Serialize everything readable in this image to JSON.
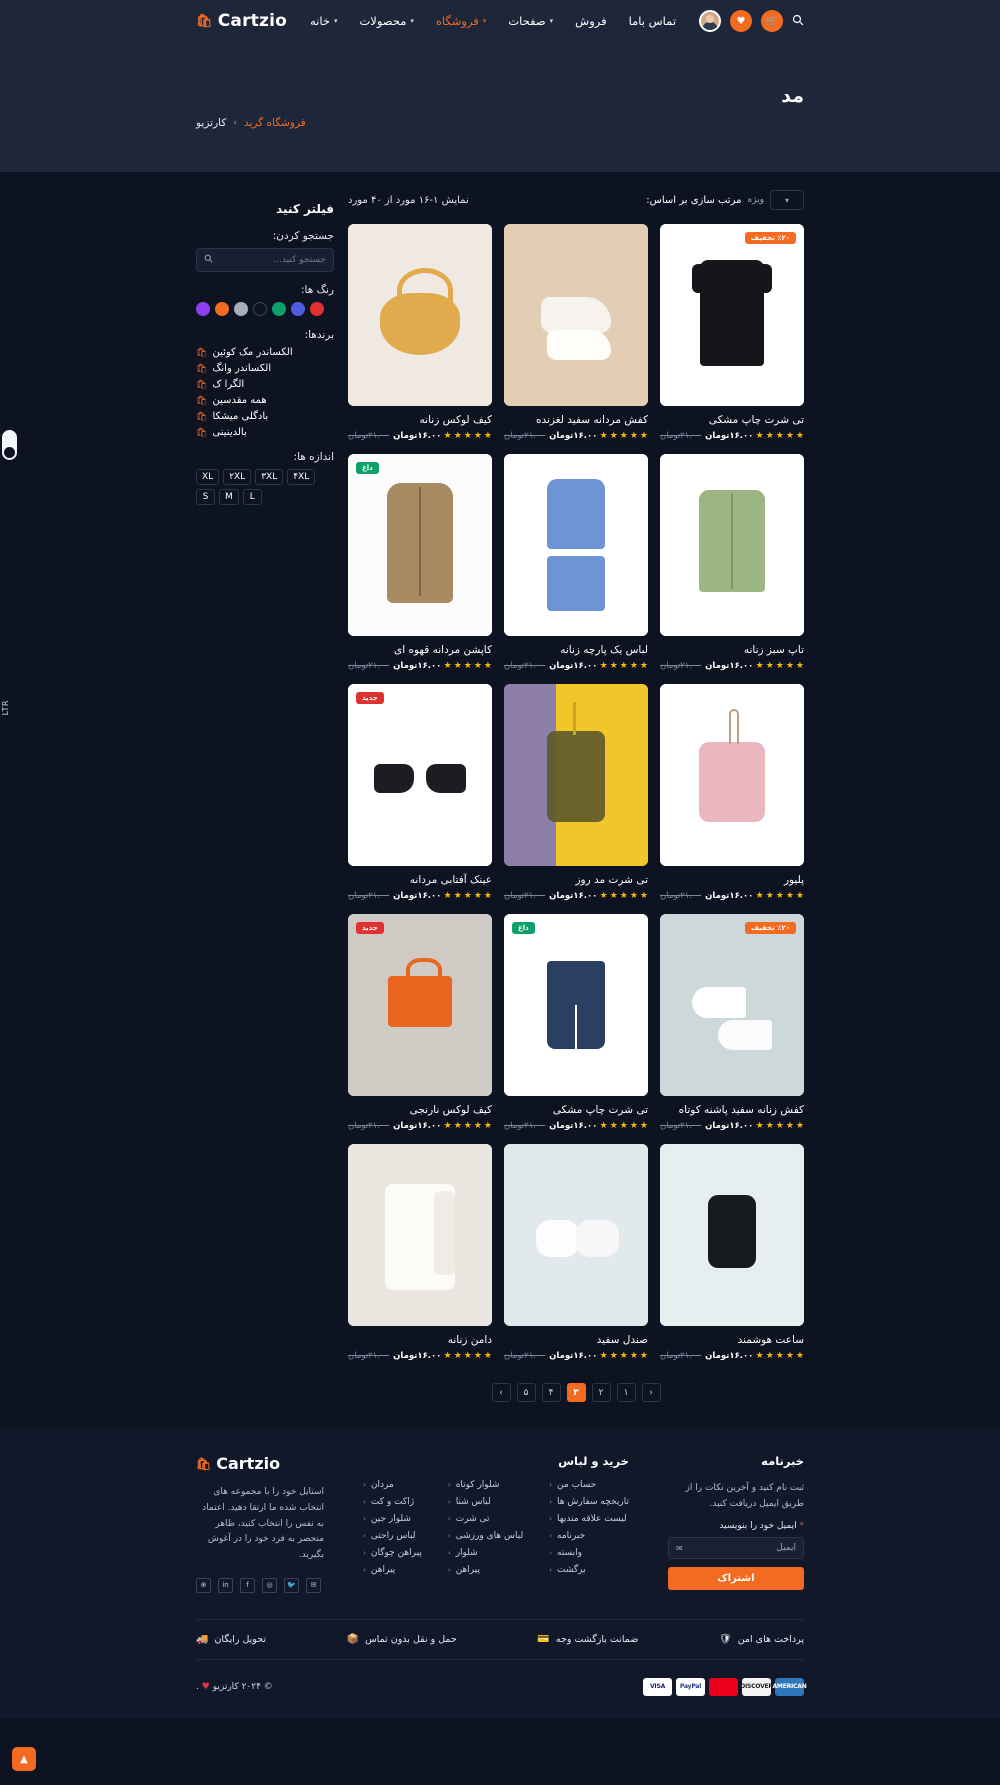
{
  "brand": {
    "name": "Cartzio",
    "icon": "shopping-bag-icon"
  },
  "nav": {
    "items": [
      {
        "label": "خانه",
        "has_caret": true,
        "active": false
      },
      {
        "label": "محصولات",
        "has_caret": true,
        "active": false
      },
      {
        "label": "فروشگاه",
        "has_caret": true,
        "active": true
      },
      {
        "label": "صفحات",
        "has_caret": true,
        "active": false
      },
      {
        "label": "فروش",
        "has_caret": false,
        "active": false
      },
      {
        "label": "تماس باما",
        "has_caret": false,
        "active": false
      }
    ],
    "icons": [
      "search-icon",
      "cart-icon",
      "heart-icon",
      "avatar"
    ]
  },
  "page": {
    "title": "مد",
    "breadcrumb": {
      "home": "کارتزیو",
      "separator": "›",
      "current": "فروشگاه گرید"
    }
  },
  "sidebar": {
    "title": "فیلتر کنید",
    "search_label": "جستجو کردن:",
    "search_placeholder": "جستجو کنید...",
    "colors_label": "رنگ ها:",
    "colors": [
      "#e03131",
      "#4f5ee0",
      "#0ea06a",
      "#0d1321",
      "#a7adb8",
      "#f26b21",
      "#8e3ff0"
    ],
    "brands_label": "برندها:",
    "brands": [
      "الکساندر مک کوئین",
      "الکساندر وانگ",
      "الگرا ک",
      "همه مقدسین",
      "بادگلی میشکا",
      "بالدینینی"
    ],
    "sizes_label": "اندازه ها:",
    "sizes": [
      "S",
      "M",
      "L",
      "XL",
      "۲XL",
      "۳XL",
      "۴XL"
    ]
  },
  "toolbar": {
    "result_count": "نمایش ۱-۱۶ مورد از ۴۰ مورد",
    "sort_label": "مرتب سازی بر اساس:",
    "sort_value": "ویژه",
    "sort_caret": "chevron-down-icon"
  },
  "products": [
    {
      "name": "تی شرت چاپ مشکی",
      "price": "۱۶.۰۰تومان",
      "old_price": "۲۱.۰۰تومان",
      "rating": 5,
      "badge": "٪۲۰ تخفیف",
      "badge_type": "orange",
      "art": "a-shirt"
    },
    {
      "name": "کفش مردانه سفید لغزنده",
      "price": "۱۶.۰۰تومان",
      "old_price": "۲۱.۰۰تومان",
      "rating": 5,
      "badge": "",
      "badge_type": "",
      "art": "a-shoe"
    },
    {
      "name": "کیف لوکس زنانه",
      "price": "۱۶.۰۰تومان",
      "old_price": "۲۱.۰۰تومان",
      "rating": 5,
      "badge": "",
      "badge_type": "",
      "art": "a-bag"
    },
    {
      "name": "تاپ سبز زنانه",
      "price": "۱۶.۰۰تومان",
      "old_price": "۲۱.۰۰تومان",
      "rating": 5,
      "badge": "",
      "badge_type": "",
      "art": "a-green"
    },
    {
      "name": "لباس یک پارچه زنانه",
      "price": "۱۶.۰۰تومان",
      "old_price": "۲۱.۰۰تومان",
      "rating": 5,
      "badge": "",
      "badge_type": "",
      "art": "a-dress"
    },
    {
      "name": "کاپشن مردانه قهوه ای",
      "price": "۱۶.۰۰تومان",
      "old_price": "۲۱.۰۰تومان",
      "rating": 5,
      "badge": "داغ",
      "badge_type": "green",
      "art": "a-jacket"
    },
    {
      "name": "پلیور",
      "price": "۱۶.۰۰تومان",
      "old_price": "۲۱.۰۰تومان",
      "rating": 5,
      "badge": "",
      "badge_type": "",
      "art": "a-pull"
    },
    {
      "name": "تی شرت مد روز",
      "price": "۱۶.۰۰تومان",
      "old_price": "۲۱.۰۰تومان",
      "rating": 5,
      "badge": "",
      "badge_type": "",
      "art": "a-tee"
    },
    {
      "name": "عینک آفتابی مردانه",
      "price": "۱۶.۰۰تومان",
      "old_price": "۲۱.۰۰تومان",
      "rating": 5,
      "badge": "جدید",
      "badge_type": "red",
      "art": "a-glass"
    },
    {
      "name": "کفش زنانه سفید پاشنه کوتاه",
      "price": "۱۶.۰۰تومان",
      "old_price": "۲۱.۰۰تومان",
      "rating": 5,
      "badge": "٪۲۰ تخفیف",
      "badge_type": "orange",
      "art": "a-heel"
    },
    {
      "name": "تی شرت چاپ مشکی",
      "price": "۱۶.۰۰تومان",
      "old_price": "۲۱.۰۰تومان",
      "rating": 5,
      "badge": "داغ",
      "badge_type": "green",
      "art": "a-short"
    },
    {
      "name": "کیف لوکس نارنجی",
      "price": "۱۶.۰۰تومان",
      "old_price": "۲۱.۰۰تومان",
      "rating": 5,
      "badge": "جدید",
      "badge_type": "red",
      "art": "a-obag"
    },
    {
      "name": "ساعت هوشمند",
      "price": "۱۶.۰۰تومان",
      "old_price": "۲۱.۰۰تومان",
      "rating": 5,
      "badge": "",
      "badge_type": "",
      "art": "a-watch"
    },
    {
      "name": "صندل سفید",
      "price": "۱۶.۰۰تومان",
      "old_price": "۲۱.۰۰تومان",
      "rating": 5,
      "badge": "",
      "badge_type": "",
      "art": "a-sandal"
    },
    {
      "name": "دامن زنانه",
      "price": "۱۶.۰۰تومان",
      "old_price": "۲۱.۰۰تومان",
      "rating": 5,
      "badge": "",
      "badge_type": "",
      "art": "a-skirt"
    }
  ],
  "pagination": {
    "prev": "‹",
    "next": "›",
    "pages": [
      "۱",
      "۲",
      "۳",
      "۴",
      "۵"
    ],
    "active": "۳"
  },
  "footer": {
    "brand": "Cartzio",
    "about": "استایل خود را با مجموعه های انتخاب شده ما ارتقا دهید. اعتماد به نفس را انتخاب کنید، ظاهر منحصر به فرد خود را در آغوش بگیرید.",
    "socials": [
      "globe-icon",
      "linkedin-icon",
      "facebook-icon",
      "instagram-icon",
      "twitter-icon",
      "mail-icon"
    ],
    "shop": {
      "title": "خرید و لباس",
      "col1": [
        "مردان",
        "ژاکت و کت",
        "شلوار جین",
        "لباس راحتی",
        "پیراهن چوگان",
        "پیراهن"
      ],
      "col2": [
        "شلوار کوتاه",
        "لباس شنا",
        "تی شرت",
        "لباس های ورزشی",
        "شلوار",
        "پیراهن"
      ],
      "col3": [
        "حساب من",
        "تاریخچه سفارش ها",
        "لیست علاقه مندیها",
        "خبرنامه",
        "وابسته",
        "برگشت"
      ]
    },
    "newsletter": {
      "title": "خبرنامه",
      "text": "ثبت نام کنید و آخرین نکات را از طریق ایمیل دریافت کنید.",
      "field_label": "ایمیل خود را بنویسید",
      "required": "*",
      "placeholder": "ایمیل",
      "button": "اشتراک"
    },
    "features": [
      {
        "icon": "truck-icon",
        "label": "تحویل رایگان"
      },
      {
        "icon": "box-icon",
        "label": "حمل و نقل بدون تماس"
      },
      {
        "icon": "refund-icon",
        "label": "ضمانت بازگشت وجه"
      },
      {
        "icon": "shield-icon",
        "label": "پرداخت های امن"
      }
    ],
    "copyright": "© ۲۰۲۴ کارتزیو",
    "heart": "♥",
    "copyright_suffix": ".",
    "payment_cards": [
      {
        "label": "VISA",
        "bg": "#ffffff",
        "fg": "#1a1f71"
      },
      {
        "label": "PayPal",
        "bg": "#ffffff",
        "fg": "#253b80"
      },
      {
        "label": "",
        "bg": "#eb001b",
        "fg": "#f79e1b"
      },
      {
        "label": "DISCOVER",
        "bg": "#f4f4f4",
        "fg": "#231f20"
      },
      {
        "label": "AMERICAN",
        "bg": "#2e77bc",
        "fg": "#ffffff"
      }
    ]
  },
  "widgets": {
    "direction_tag": "LTR",
    "to_top": "▲"
  }
}
